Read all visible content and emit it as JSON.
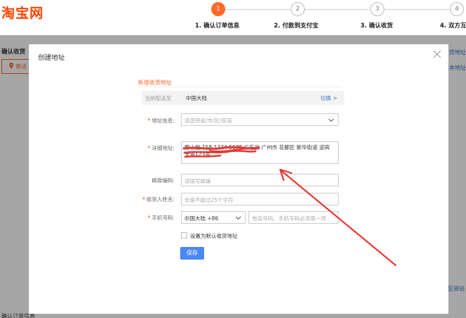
{
  "brand": {
    "logo_text": "淘宝网",
    "accent_color": "#ff4400"
  },
  "steps": [
    {
      "number": "1",
      "label": "1. 确认订单信息",
      "active": true
    },
    {
      "number": "2",
      "label": "2. 付款到支付宝",
      "active": false
    },
    {
      "number": "3",
      "label": "3. 确认收货",
      "active": false
    },
    {
      "number": "4",
      "label": "4. 双方互",
      "active": false
    }
  ],
  "background": {
    "confirm_label": "确认收货",
    "send_button_label": "寄送",
    "right_link_top": "收货地址",
    "right_link_mid": "改本地址",
    "right_link_bottom": "区驿站",
    "bottom_text": "确认订单信息"
  },
  "modal": {
    "title": "创建地址",
    "close_icon": "close-icon",
    "section_title": "新增收货地址",
    "region": {
      "label": "当前配送至",
      "value": "中国大陆",
      "switch_label": "切换 >"
    },
    "address_info": {
      "label": "地址信息:",
      "placeholder": "请选择省/市/区/街道"
    },
    "detail_address": {
      "label": "详细地址:",
      "value": "黎小姐 158 1234 5678 广东省 广州市 花都区 新华街道 迎宾大道123号"
    },
    "postal_code": {
      "label": "邮政编码:",
      "placeholder": "请填写邮编"
    },
    "recipient_name": {
      "label": "收货人姓名:",
      "placeholder": "长度不超过25个字符"
    },
    "phone": {
      "label": "手机号码:",
      "country_value": "中国大陆 +86",
      "placeholder": "电话号码、手机号码必须填一项"
    },
    "default_checkbox_label": "设置为默认收货地址",
    "save_label": "保存"
  },
  "colors": {
    "step_active": "#ff6a2a",
    "link": "#3c70c6",
    "save_button": "#4a88f5",
    "annotation_red": "#e53935"
  }
}
